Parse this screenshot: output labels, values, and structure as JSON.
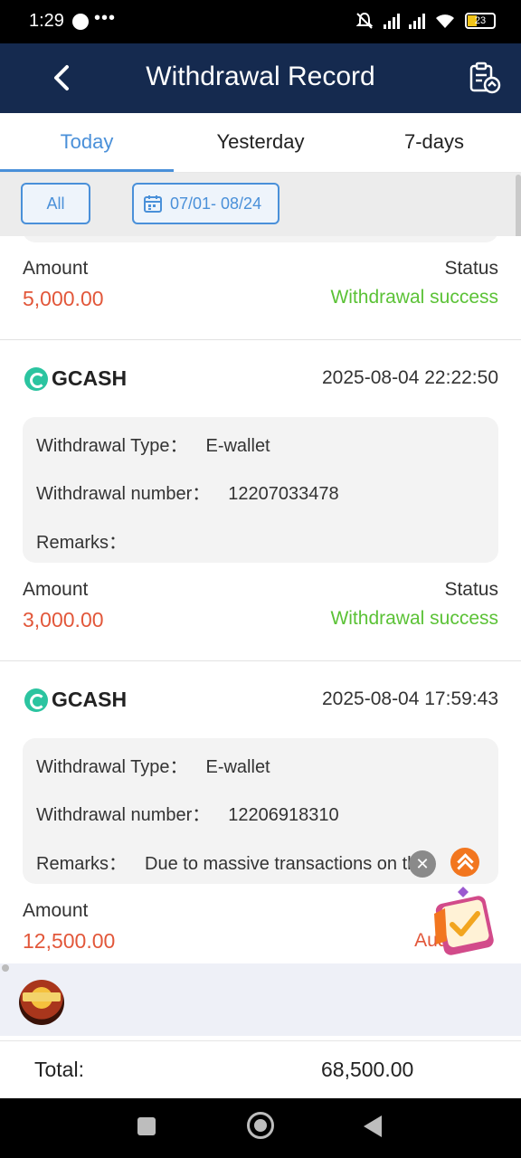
{
  "status_bar": {
    "time": "1:29",
    "extra": "•••",
    "battery": "23"
  },
  "header": {
    "title": "Withdrawal Record"
  },
  "tabs": [
    {
      "label": "Today"
    },
    {
      "label": "Yesterday"
    },
    {
      "label": "7-days"
    }
  ],
  "filter": {
    "all_label": "All",
    "date_range": "07/01- 08/24"
  },
  "records": [
    {
      "amount_label": "Amount",
      "amount": "5,000.00",
      "status_label": "Status",
      "status": "Withdrawal success"
    },
    {
      "brand": "GCASH",
      "timestamp": "2025-08-04 22:22:50",
      "type_label": "Withdrawal Type：",
      "type": "E-wallet",
      "number_label": "Withdrawal number：",
      "number": "12207033478",
      "remarks_label": "Remarks：",
      "remarks": "",
      "amount_label": "Amount",
      "amount": "3,000.00",
      "status_label": "Status",
      "status": "Withdrawal success"
    },
    {
      "brand": "GCASH",
      "timestamp": "2025-08-04 17:59:43",
      "type_label": "Withdrawal Type：",
      "type": "E-wallet",
      "number_label": "Withdrawal number：",
      "number": "12206918310",
      "remarks_label": "Remarks：",
      "remarks": "Due to massive transactions on the",
      "amount_label": "Amount",
      "amount": "12,500.00",
      "status": "Audit"
    }
  ],
  "total": {
    "label": "Total:",
    "value": "68,500.00"
  },
  "colors": {
    "header_bg": "#152a4f",
    "accent": "#4a90d9",
    "amount": "#e2573a",
    "success": "#5bc236"
  }
}
